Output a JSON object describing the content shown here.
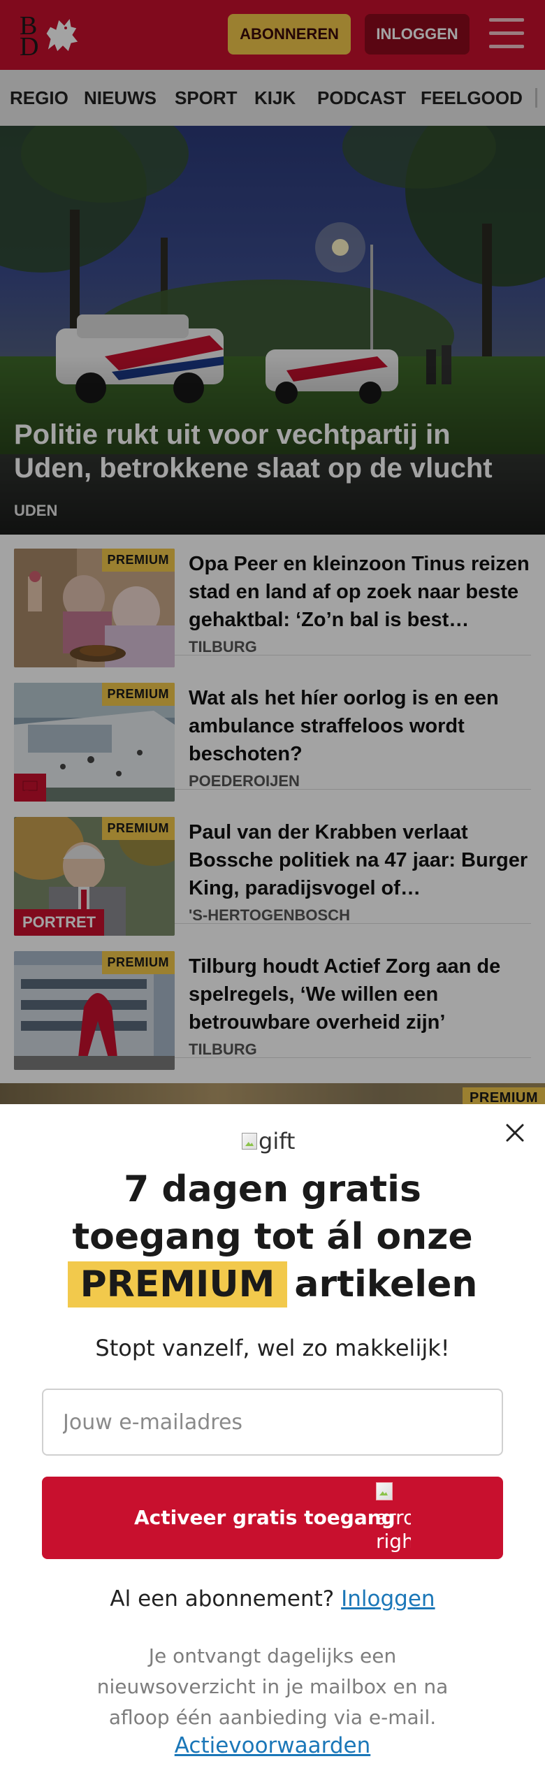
{
  "header": {
    "logo_text": "BD",
    "subscribe_label": "ABONNEREN",
    "login_label": "INLOGGEN",
    "menu_icon": "hamburger-menu-icon",
    "brand_color": "#c8102e",
    "accent_color": "#f2c94c"
  },
  "nav": {
    "items": [
      "REGIO",
      "NIEUWS",
      "SPORT",
      "KIJK",
      "PODCAST",
      "FEELGOOD"
    ]
  },
  "hero": {
    "title": "Politie rukt uit voor vechtpartij in Uden, betrokkene slaat op de vlucht",
    "location": "UDEN"
  },
  "articles": [
    {
      "badge": "PREMIUM",
      "title": "Opa Peer en kleinzoon Tinus reizen stad en land af op zoek naar beste gehaktbal: ‘Zo’n bal is best moeilijk’",
      "location": "TILBURG"
    },
    {
      "badge": "PREMIUM",
      "title": "Wat als het híer oorlog is en een ambulance straffeloos wordt beschoten?",
      "location": "POEDEROIJEN",
      "overlay_icon": "comment-icon"
    },
    {
      "badge": "PREMIUM",
      "title": "Paul van der Krabben verlaat Bossche politiek na 47 jaar: Burger King, paradijsvogel of stadsbestuurder",
      "location": "'S-HERTOGENBOSCH",
      "overlay_label": "PORTRET"
    },
    {
      "badge": "PREMIUM",
      "title": "Tilburg houdt Actief Zorg aan de spelregels, ‘We willen een betrouwbare overheid zijn’",
      "location": "TILBURG"
    }
  ],
  "next_badge": "PREMIUM",
  "modal": {
    "gift_alt": "gift",
    "title_line1": "7 dagen gratis",
    "title_line2": "toegang tot ál onze",
    "title_premium": "PREMIUM",
    "title_tail": "artikelen",
    "subtitle": "Stopt vanzelf, wel zo makkelijk!",
    "email_placeholder": "Jouw e-mailadres",
    "cta_label": "Activeer gratis toegang",
    "cta_arrow_alt": "arrow right",
    "login_prompt": "Al een abonnement?",
    "login_link": "Inloggen",
    "info": "Je ontvangt dagelijks een nieuwsoverzicht in je mailbox en na afloop één aanbieding via e-mail.",
    "terms_link": "Actievoorwaarden",
    "close_icon": "close-icon"
  }
}
